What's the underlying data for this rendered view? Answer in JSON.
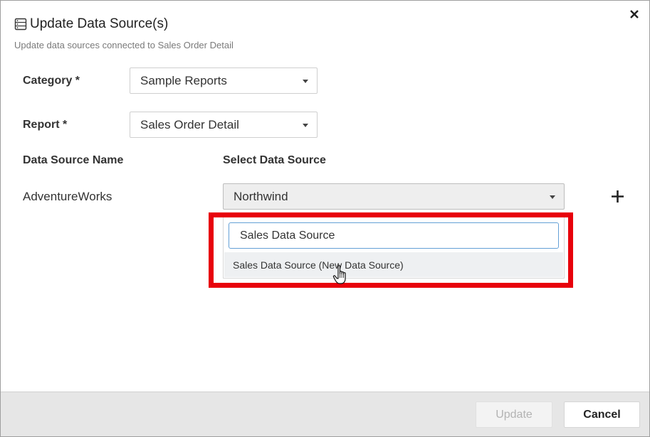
{
  "dialog": {
    "title": "Update Data Source(s)",
    "title_icon": "database-icon",
    "subtitle": "Update data sources connected to Sales Order Detail",
    "close_icon": "close-icon"
  },
  "form": {
    "category": {
      "label": "Category *",
      "value": "Sample Reports"
    },
    "report": {
      "label": "Report *",
      "value": "Sales Order Detail"
    }
  },
  "mapping": {
    "col_name_header": "Data Source Name",
    "col_select_header": "Select Data Source",
    "rows": [
      {
        "name": "AdventureWorks",
        "selected": "Northwind"
      }
    ],
    "add_icon": "plus-icon"
  },
  "popup": {
    "search_value": "Sales Data Source",
    "options": [
      "Sales Data Source (New Data Source)"
    ]
  },
  "footer": {
    "update_label": "Update",
    "cancel_label": "Cancel"
  },
  "colors": {
    "highlight": "#e8000b",
    "footer_bg": "#e6e6e6",
    "search_border": "#64a0d6"
  }
}
